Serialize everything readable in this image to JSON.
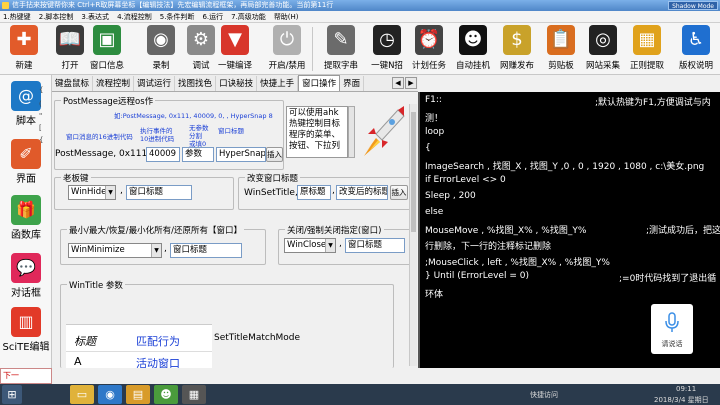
{
  "window": {
    "title": "信手拈来按键帮你来 Ctrl+R取屏幕坐标【编辑技法】先宏编辑流程框架，再局部完善功能。当前第11行",
    "right_label": "Shadow Mode"
  },
  "menu": [
    "1.热键键",
    "2.脚本控制",
    "3.表达式",
    "4.流程控制",
    "5.条件判断",
    "6.运行",
    "7.高级功能",
    "帮助(H)"
  ],
  "toolbar": [
    {
      "label": "新建",
      "icon": "new-document-icon",
      "color": "#e25b2a",
      "glyph": "✚"
    },
    {
      "label": "打开",
      "icon": "open-book-icon",
      "color": "#3b3b3b",
      "glyph": "📖"
    },
    {
      "label": "窗口信息",
      "icon": "window-info-icon",
      "color": "#2d8c3f",
      "glyph": "▣"
    },
    {
      "label": "录制",
      "icon": "webcam-icon",
      "color": "#666",
      "glyph": "◉"
    },
    {
      "label": "调试",
      "icon": "gear-icon",
      "color": "#8a8a8a",
      "glyph": "⚙"
    },
    {
      "label": "一键编译",
      "icon": "bucket-icon",
      "color": "#d8362b",
      "glyph": "▼"
    },
    {
      "label": "开启/禁用",
      "icon": "power-icon",
      "color": "#b0b0b0",
      "glyph": "⏻"
    },
    {
      "label": "提取字串",
      "icon": "pen-icon",
      "color": "#6b6b6b",
      "glyph": "✎"
    },
    {
      "label": "一键N招",
      "icon": "clock-icon",
      "color": "#222",
      "glyph": "◷"
    },
    {
      "label": "计划任务",
      "icon": "alarm-clock-icon",
      "color": "#444",
      "glyph": "⏰"
    },
    {
      "label": "自动挂机",
      "icon": "mascot-icon",
      "color": "#111",
      "glyph": "☻"
    },
    {
      "label": "网赚发布",
      "icon": "money-icon",
      "color": "#c9a22a",
      "glyph": "$"
    },
    {
      "label": "剪贴板",
      "icon": "clipboard-icon",
      "color": "#d96d1f",
      "glyph": "📋"
    },
    {
      "label": "网站采集",
      "icon": "mickey-icon",
      "color": "#222",
      "glyph": "◎"
    },
    {
      "label": "正则提取",
      "icon": "regex-icon",
      "color": "#e0a21c",
      "glyph": "▦"
    },
    {
      "label": "版权说明",
      "icon": "accessibility-icon",
      "color": "#1f6fd0",
      "glyph": "♿"
    }
  ],
  "sidebar": [
    {
      "label": "脚本",
      "icon": "script-book-icon",
      "color": "#1d78c6",
      "glyph": "@"
    },
    {
      "label": "界面",
      "icon": "ruler-pen-icon",
      "color": "#e05a2a",
      "glyph": "✐"
    },
    {
      "label": "函数库",
      "icon": "gift-box-icon",
      "color": "#3ea34b",
      "glyph": "🎁"
    },
    {
      "label": "对话框",
      "icon": "chat-icon",
      "color": "#e0285a",
      "glyph": "💬"
    },
    {
      "label": "SciTE编辑",
      "icon": "popcorn-icon",
      "color": "#e23a28",
      "glyph": "▥"
    }
  ],
  "sidebar_rightcol": [
    "{",
    "(",
    "\"",
    "[",
    "{"
  ],
  "tabs": [
    "键盘鼠标",
    "流程控制",
    "调试运行",
    "找图找色",
    "口诀秘技",
    "快捷上手",
    "窗口操作",
    "界面"
  ],
  "active_tab": 6,
  "postmessage": {
    "title": "PostMessage远程os作",
    "anno_top": "如:PostMessage, 0x111, 40009, 0, , HyperSnap 8",
    "anno_window_msg": "窗口消息的16进制代码",
    "anno_exec": "执行事件的",
    "anno_exec2": "10进制代码",
    "anno_noparam": "无参数",
    "anno_noparam2": "分割",
    "anno_noparam3": "或填0",
    "anno_window_title": "窗口标题",
    "label": "PostMessage, 0x111,",
    "code_value": "40009",
    "param_value": "参数",
    "title_value": "HyperSnap",
    "insert_label": "插入",
    "note": "可以使用ahk 热键控制目标程序的菜单、按钮、下拉列"
  },
  "oldkey": {
    "title": "老板键",
    "select": "WinHide",
    "input": "窗口标题"
  },
  "settitle": {
    "title": "改变窗口标题",
    "label": "WinSetTitle,",
    "orig": "原标题",
    "new": "改变后的标题",
    "insert": "插入"
  },
  "minmax": {
    "title": "最小/最大/恢复/最小化所有/还原所有【窗口】",
    "select": "WinMinimize",
    "input": "窗口标题"
  },
  "close": {
    "title": "关闭/强制关闭指定(窗口)",
    "select": "WinClose",
    "input": "窗口标题"
  },
  "wintitle": {
    "title": "WinTitle 参数",
    "col1": "标题",
    "col2": "匹配行为",
    "row_a": "A",
    "row_a_val": "活动窗口",
    "side": "SetTitleMatchMode"
  },
  "editor_lines": [
    {
      "code": "F1::",
      "comment": ";默认热键为F1,方便调试与内"
    },
    {
      "code": "测！",
      "comment": ""
    },
    {
      "code": "loop",
      "comment": ""
    },
    {
      "code": "{",
      "comment": ""
    },
    {
      "code": "ImageSearch , 找图_X , 找图_Y ,0 , 0 , 1920 , 1080 , c:\\美女.png",
      "comment": ""
    },
    {
      "code": "if ErrorLevel   <> 0",
      "comment": ""
    },
    {
      "code": "Sleep , 200",
      "comment": ""
    },
    {
      "code": "else",
      "comment": ""
    },
    {
      "code": "MouseMove ,  %找图_X% , %找图_Y%",
      "comment": ";测试成功后，把这"
    },
    {
      "code": "行删除，下一行的注释标记删除",
      "comment": ""
    },
    {
      "code": ";MouseClick , left , %找图_X% , %找图_Y%",
      "comment": ""
    },
    {
      "code": "} Until  (ErrorLevel   = 0)",
      "comment": ";=0时代码找到了退出循"
    },
    {
      "code": "环体",
      "comment": ""
    }
  ],
  "voice_label": "请说话",
  "status_text": "下一",
  "taskbar": {
    "tray_text": "快捷访问",
    "time": "09:11",
    "date": "2018/3/4 星期日"
  }
}
